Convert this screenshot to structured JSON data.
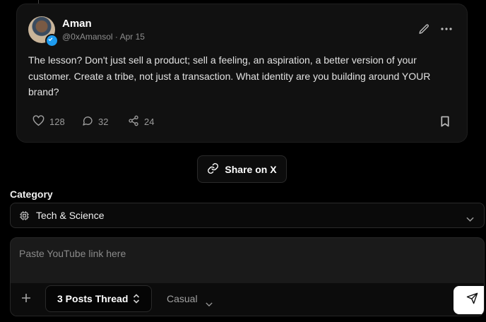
{
  "post": {
    "author_name": "Aman",
    "author_handle": "@0xAmansol",
    "date": "Apr 15",
    "separator": "·",
    "text": "The lesson? Don't just sell a product; sell a feeling, an aspiration, a better version of your customer. Create a tribe, not just a transaction. What identity are you building around YOUR brand?",
    "likes": "128",
    "replies": "32",
    "shares": "24"
  },
  "share_button": {
    "label": "Share on X"
  },
  "category": {
    "label": "Category",
    "selected": "Tech & Science"
  },
  "composer": {
    "placeholder": "Paste YouTube link here",
    "thread_option": "3 Posts Thread",
    "tone_option": "Casual"
  },
  "icons": {
    "avatar": "avatar",
    "verified": "verified-badge-icon",
    "edit": "pencil-icon",
    "more": "more-horizontal-icon",
    "like": "heart-icon",
    "reply": "comment-icon",
    "share": "share-icon",
    "bookmark": "bookmark-icon",
    "link": "link-icon",
    "category": "cpu-icon",
    "add": "plus-icon",
    "send": "send-icon"
  },
  "colors": {
    "background": "#000000",
    "card": "#111111",
    "verified": "#1d9bf0",
    "muted_text": "#8e8e8e"
  }
}
